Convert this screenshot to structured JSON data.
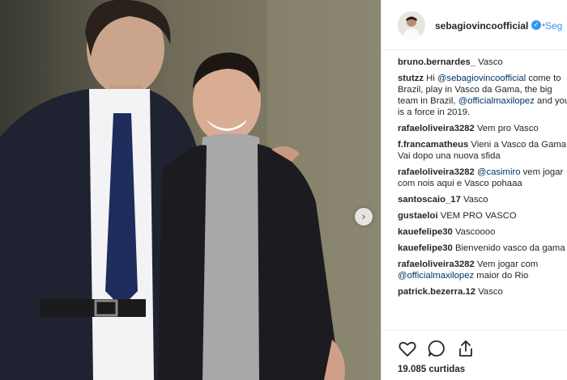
{
  "post": {
    "username": "sebagiovincoofficial",
    "verified_icon": "verified-badge-icon",
    "follow_label": "Seg",
    "likes_text": "19.085 curtidas"
  },
  "comments": [
    {
      "user": "bruno.bernardes_",
      "parts": [
        {
          "t": " Vasco"
        }
      ]
    },
    {
      "user": "stutzz",
      "parts": [
        {
          "t": " Hi "
        },
        {
          "m": "@sebagiovincoofficial"
        },
        {
          "t": " come to Brazil, play in Vasco da Gama, the big team in Brazil, "
        },
        {
          "m": "@officialmaxilopez"
        },
        {
          "t": " and you is a force in 2019."
        }
      ]
    },
    {
      "user": "rafaeloliveira3282",
      "parts": [
        {
          "t": " Vem pro Vasco"
        }
      ]
    },
    {
      "user": "f.francamatheus",
      "parts": [
        {
          "t": " Vieni a Vasco da Gama , Vai dopo una nuova sfida"
        }
      ]
    },
    {
      "user": "rafaeloliveira3282",
      "parts": [
        {
          "t": " "
        },
        {
          "m": "@casimiro"
        },
        {
          "t": " vem jogar com nois aqui e Vasco pohaaa"
        }
      ]
    },
    {
      "user": "santoscaio_17",
      "parts": [
        {
          "t": " Vasco"
        }
      ]
    },
    {
      "user": "gustaeloi",
      "parts": [
        {
          "t": " VEM PRO VASCO"
        }
      ]
    },
    {
      "user": "kauefelipe30",
      "parts": [
        {
          "t": " Vascoooo"
        }
      ]
    },
    {
      "user": "kauefelipe30",
      "parts": [
        {
          "t": " Bienvenido vasco da gama"
        }
      ]
    },
    {
      "user": "rafaeloliveira3282",
      "parts": [
        {
          "t": " Vem jogar com "
        },
        {
          "m": "@officialmaxilopez"
        },
        {
          "t": " maior do Rio"
        }
      ]
    },
    {
      "user": "patrick.bezerra.12",
      "parts": [
        {
          "t": " Vasco"
        }
      ]
    }
  ],
  "icons": {
    "next": "chevron-right-icon",
    "like": "heart-icon",
    "comment": "comment-icon",
    "share": "share-icon"
  },
  "glyphs": {
    "next": "›",
    "verified": "✓",
    "dot": "•"
  },
  "colors": {
    "accent": "#3897f0",
    "mention": "#003569",
    "text": "#262626"
  }
}
